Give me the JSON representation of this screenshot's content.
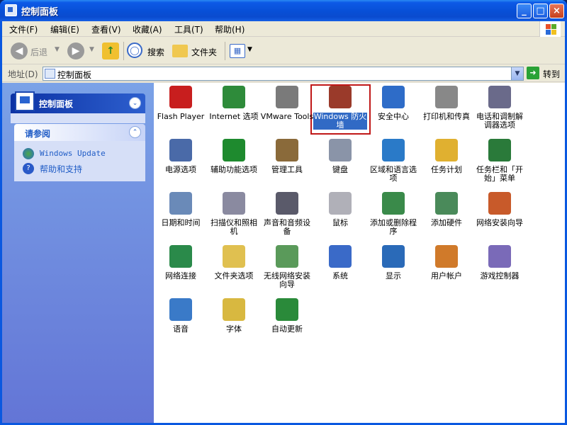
{
  "window": {
    "title": "控制面板"
  },
  "title_buttons": {
    "minimize": "_",
    "maximize": "□",
    "close": "×"
  },
  "menu": [
    "文件(F)",
    "编辑(E)",
    "查看(V)",
    "收藏(A)",
    "工具(T)",
    "帮助(H)"
  ],
  "toolbar": {
    "back": "后退",
    "search": "搜索",
    "folders": "文件夹"
  },
  "address": {
    "label": "地址(D)",
    "value": "控制面板",
    "go": "转到"
  },
  "left": {
    "panel_title": "控制面板",
    "see_also_title": "请参阅",
    "links": [
      "Windows Update",
      "帮助和支持"
    ]
  },
  "items": [
    {
      "label": "Flash Player",
      "icon": "flash-icon",
      "color": "#C81E1E"
    },
    {
      "label": "Internet 选项",
      "icon": "internet-options-icon",
      "color": "#2E8B3A"
    },
    {
      "label": "VMware Tools",
      "icon": "vmware-icon",
      "color": "#7A7A7A"
    },
    {
      "label": "Windows 防火墙",
      "icon": "firewall-icon",
      "color": "#9A3A2A"
    },
    {
      "label": "安全中心",
      "icon": "security-center-icon",
      "color": "#2E6CC8"
    },
    {
      "label": "打印机和传真",
      "icon": "printer-icon",
      "color": "#888888"
    },
    {
      "label": "电话和调制解调器选项",
      "icon": "phone-icon",
      "color": "#6A6A8A"
    },
    {
      "label": "电源选项",
      "icon": "power-icon",
      "color": "#4A6AA8"
    },
    {
      "label": "辅助功能选项",
      "icon": "accessibility-icon",
      "color": "#1E8A2E"
    },
    {
      "label": "管理工具",
      "icon": "admin-tools-icon",
      "color": "#8A6A3A"
    },
    {
      "label": "键盘",
      "icon": "keyboard-icon",
      "color": "#8A94A8"
    },
    {
      "label": "区域和语言选项",
      "icon": "globe-icon",
      "color": "#2A7AC8"
    },
    {
      "label": "任务计划",
      "icon": "scheduled-tasks-icon",
      "color": "#E0B030"
    },
    {
      "label": "任务栏和「开始」菜单",
      "icon": "taskbar-icon",
      "color": "#2A7A3A"
    },
    {
      "label": "日期和时间",
      "icon": "clock-icon",
      "color": "#6A8AB8"
    },
    {
      "label": "扫描仪和照相机",
      "icon": "scanner-icon",
      "color": "#8A8AA0"
    },
    {
      "label": "声音和音频设备",
      "icon": "speaker-icon",
      "color": "#5A5A6A"
    },
    {
      "label": "鼠标",
      "icon": "mouse-icon",
      "color": "#B0B0B8"
    },
    {
      "label": "添加或删除程序",
      "icon": "add-remove-programs-icon",
      "color": "#3A8A4A"
    },
    {
      "label": "添加硬件",
      "icon": "add-hardware-icon",
      "color": "#4A8A5A"
    },
    {
      "label": "网络安装向导",
      "icon": "network-setup-icon",
      "color": "#C85A2A"
    },
    {
      "label": "网络连接",
      "icon": "network-connections-icon",
      "color": "#2A8A4A"
    },
    {
      "label": "文件夹选项",
      "icon": "folder-options-icon",
      "color": "#E0C050"
    },
    {
      "label": "无线网络安装向导",
      "icon": "wireless-icon",
      "color": "#5A9A5A"
    },
    {
      "label": "系统",
      "icon": "system-icon",
      "color": "#3A6AC8"
    },
    {
      "label": "显示",
      "icon": "display-icon",
      "color": "#2A6AB8"
    },
    {
      "label": "用户帐户",
      "icon": "user-accounts-icon",
      "color": "#D07A2A"
    },
    {
      "label": "游戏控制器",
      "icon": "game-controller-icon",
      "color": "#7A6AB8"
    },
    {
      "label": "语音",
      "icon": "speech-icon",
      "color": "#3A7AC8"
    },
    {
      "label": "字体",
      "icon": "fonts-icon",
      "color": "#D8B840"
    },
    {
      "label": "自动更新",
      "icon": "automatic-updates-icon",
      "color": "#2A8A3A"
    }
  ],
  "selected_item": "Windows 防火墙"
}
